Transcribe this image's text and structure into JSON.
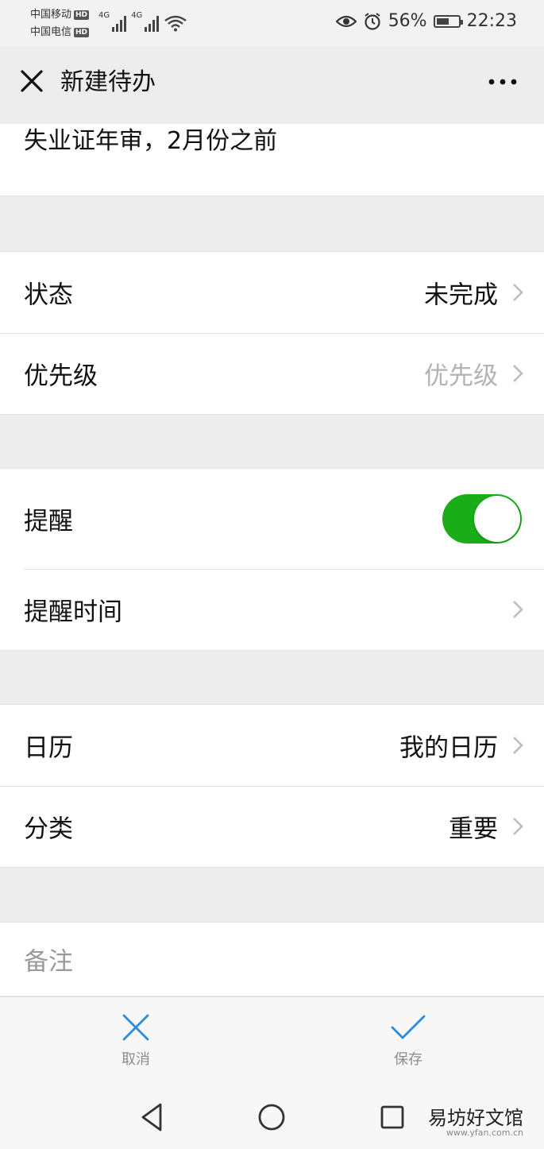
{
  "status_bar": {
    "carrier_1": "中国移动",
    "carrier_2": "中国电信",
    "hd_badge": "HD",
    "network_1": "4G",
    "network_2": "4G",
    "battery_percent": "56%",
    "battery_level": 0.56,
    "time": "22:23",
    "icons": [
      "eye-icon",
      "alarm-icon",
      "battery-icon",
      "wifi-icon",
      "signal-icon"
    ]
  },
  "header": {
    "title": "新建待办",
    "close_icon": "close-icon",
    "more_icon": "more-icon"
  },
  "todo": {
    "title": "失业证年审，2月份之前"
  },
  "fields": {
    "status": {
      "label": "状态",
      "value": "未完成"
    },
    "priority": {
      "label": "优先级",
      "placeholder": "优先级"
    },
    "reminder": {
      "label": "提醒",
      "enabled": true
    },
    "reminder_time": {
      "label": "提醒时间"
    },
    "calendar": {
      "label": "日历",
      "value": "我的日历"
    },
    "category": {
      "label": "分类",
      "value": "重要"
    }
  },
  "notes": {
    "placeholder": "备注"
  },
  "actions": {
    "cancel_label": "取消",
    "save_label": "保存"
  },
  "nav": {
    "icons": [
      "back-icon",
      "home-icon",
      "recents-icon"
    ]
  },
  "watermark": {
    "text": "易坊好文馆",
    "sub": "www.yfan.com.cn"
  },
  "colors": {
    "toggle_on": "#1aad19",
    "action_blue": "#2d8cd8",
    "placeholder": "#b3b3b3"
  }
}
